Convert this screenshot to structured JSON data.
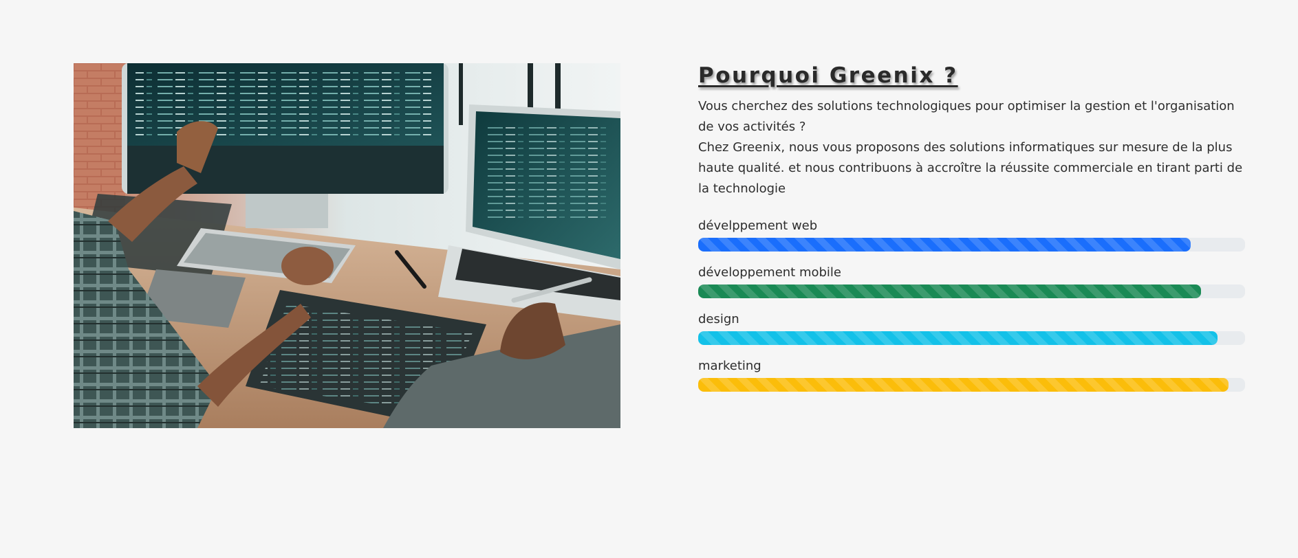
{
  "section": {
    "title": "Pourquoi Greenix ?",
    "intro_line1": "Vous cherchez des solutions technologiques pour optimiser la gestion et l'organisation de vos activités ?",
    "intro_line2": "Chez Greenix, nous vous proposons des solutions informatiques sur mesure de la plus haute qualité. et nous contribuons à accroître la réussite commerciale en tirant parti de la technologie"
  },
  "skills": [
    {
      "label": "dévelppement web",
      "percent": 90,
      "color": "#1a6efc"
    },
    {
      "label": "développement mobile",
      "percent": 92,
      "color": "#1a8a55"
    },
    {
      "label": "design",
      "percent": 95,
      "color": "#13c1e8"
    },
    {
      "label": "marketing",
      "percent": 97,
      "color": "#fbbd0a"
    }
  ]
}
